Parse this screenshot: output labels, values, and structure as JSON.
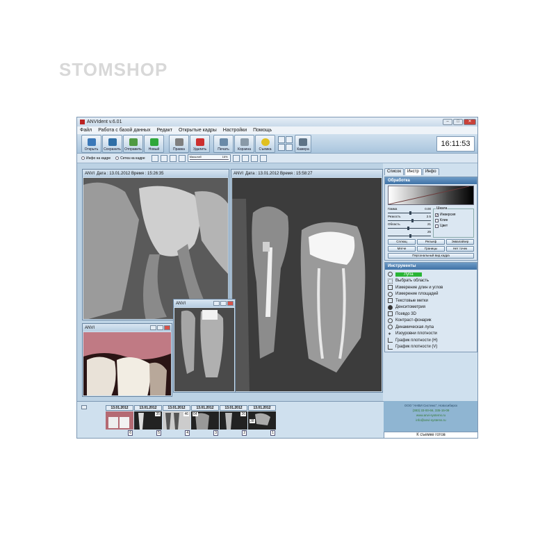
{
  "watermark": "STOMSHOP",
  "window": {
    "title": "ANVIdent v.6.01"
  },
  "menu": [
    "Файл",
    "Работа с базой данных",
    "Редакт",
    "Открытые кадры",
    "Настройки",
    "Помощь"
  ],
  "toolbar": {
    "buttons": [
      {
        "label": "Открыть",
        "color": "#3b78b8"
      },
      {
        "label": "Сохранить",
        "color": "#2e6ea6"
      },
      {
        "label": "Отправить",
        "color": "#4f9a43"
      },
      {
        "label": "Новый",
        "color": "#2fa73a"
      },
      {
        "label": "Правка",
        "color": "#7f7f7f"
      },
      {
        "label": "Удалить",
        "color": "#cc2f2f"
      },
      {
        "label": "Печать",
        "color": "#6a8aa8"
      },
      {
        "label": "Корзина",
        "color": "#8a9aa8"
      },
      {
        "label": "Съемка",
        "color": "#e0c020"
      }
    ],
    "camera_label": "Камера",
    "clock": "16:11:53"
  },
  "toolbar2": {
    "info_label": "Инфо на кадре",
    "grid_label": "Сетка на кадре",
    "zoom_label": "Масштаб",
    "zoom_value": "16%"
  },
  "windows": {
    "w1": {
      "app": "ANVI",
      "info": "Дата : 13.01.2012 Время : 15:26:35"
    },
    "w2": {
      "app": "ANVI",
      "info": "Дата : 13.01.2012 Время : 15:58:27"
    },
    "w3": {
      "app": "ANVI"
    },
    "w4": {
      "app": "ANVI"
    }
  },
  "panel": {
    "tabs": [
      "Список",
      "Инстр",
      "Инфо"
    ],
    "processing": {
      "title": "Обработка",
      "sliders": [
        {
          "label": "Гамма",
          "value": "0.00",
          "pos": 0.5
        },
        {
          "label": "Резкость",
          "value": "2.5",
          "pos": 0.55
        },
        {
          "label": "Область",
          "value": "21",
          "pos": 0.45
        },
        {
          "label": "",
          "value": "25",
          "pos": 0.5
        }
      ],
      "scale_title": "Шкала",
      "scale_options": [
        {
          "label": "Инверсия",
          "checked": true
        },
        {
          "label": "Клин",
          "checked": false
        },
        {
          "label": "Цвет",
          "checked": false
        }
      ],
      "buttons_row1": [
        "Сплющ",
        "Рельеф",
        "Эквалайзер"
      ],
      "buttons_row2": [
        "Мягче",
        "Границы",
        "Нет точек"
      ],
      "button_full": "Персональный вид кадра"
    },
    "tools": {
      "title": "Инструменты",
      "items": [
        {
          "label": "Лупа",
          "selected": true
        },
        {
          "label": "Выбрать область",
          "selected": false
        },
        {
          "label": "Измерение длин и углов",
          "selected": false
        },
        {
          "label": "Измерение площадей",
          "selected": false
        },
        {
          "label": "Текстовые метки",
          "selected": false
        },
        {
          "label": "Денситометрия",
          "selected": false
        },
        {
          "label": "Псевдо 3D",
          "selected": false
        },
        {
          "label": "Контраст-фонарик",
          "selected": false
        },
        {
          "label": "Динамическая лупа",
          "selected": false
        },
        {
          "label": "Изоуровни плотности",
          "selected": false
        },
        {
          "label": "График плотности (H)",
          "selected": false
        },
        {
          "label": "График плотности (V)",
          "selected": false
        }
      ]
    }
  },
  "thumbnails": [
    {
      "date": "13.01.2012",
      "num": "6",
      "count": ""
    },
    {
      "date": "13.01.2012",
      "num": "5",
      "count": "35"
    },
    {
      "date": "13.01.2012",
      "num": "4",
      "count": "46"
    },
    {
      "date": "13.01.2012",
      "num": "3",
      "count": "64"
    },
    {
      "date": "13.01.2012",
      "num": "2",
      "count": "26"
    },
    {
      "date": "13.01.2012",
      "num": "1",
      "count": "38"
    }
  ],
  "company": {
    "line1": "ООО \"АНВИ Системс\", Новосибирск",
    "line2": "(383) 33-00-66, 335-15-09",
    "line3": "www.anvi-systems.ru",
    "line4": "info@anvi-systems.ru"
  },
  "status": "К съемке готов"
}
